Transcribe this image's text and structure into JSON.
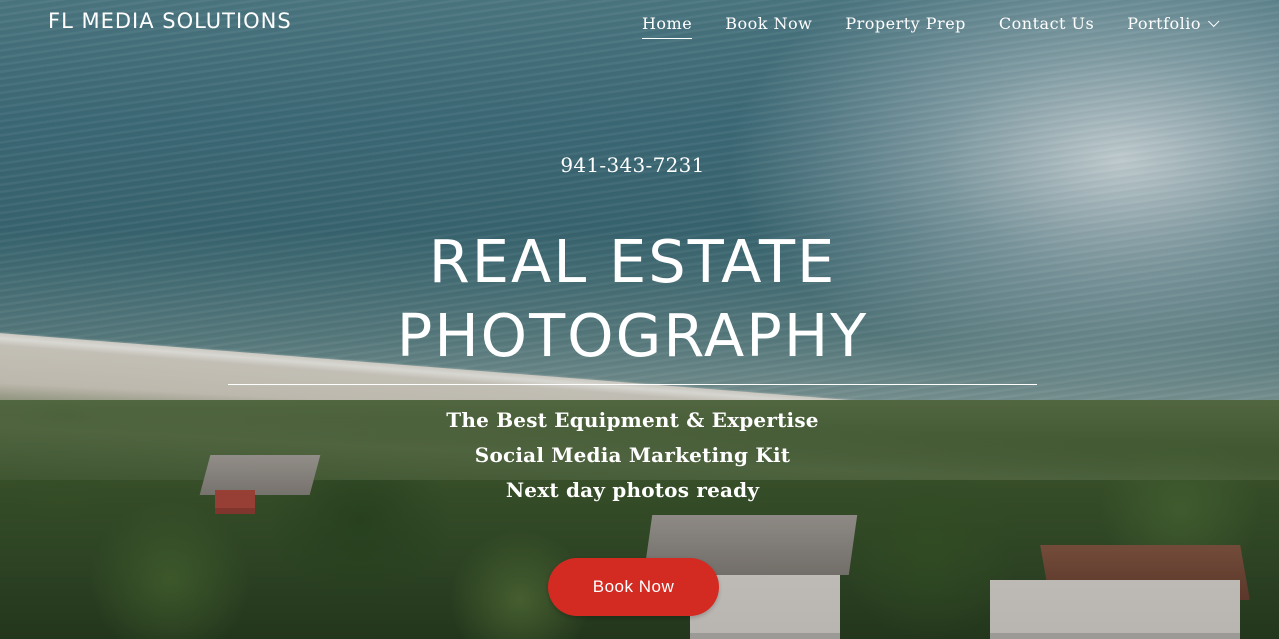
{
  "header": {
    "brand": "FL MEDIA SOLUTIONS",
    "nav": [
      {
        "label": "Home",
        "active": true
      },
      {
        "label": "Book Now",
        "active": false
      },
      {
        "label": "Property Prep",
        "active": false
      },
      {
        "label": "Contact Us",
        "active": false
      },
      {
        "label": "Portfolio",
        "active": false,
        "has_dropdown": true,
        "icon": "chevron-down-icon"
      }
    ]
  },
  "hero": {
    "phone": "941-343-7231",
    "title_line1": "REAL ESTATE",
    "title_line2": "PHOTOGRAPHY",
    "features": [
      "The Best Equipment & Expertise",
      "Social Media Marketing Kit",
      "Next day photos ready"
    ],
    "cta_label": "Book Now"
  },
  "colors": {
    "cta_background": "#d32a22",
    "text": "#ffffff"
  }
}
